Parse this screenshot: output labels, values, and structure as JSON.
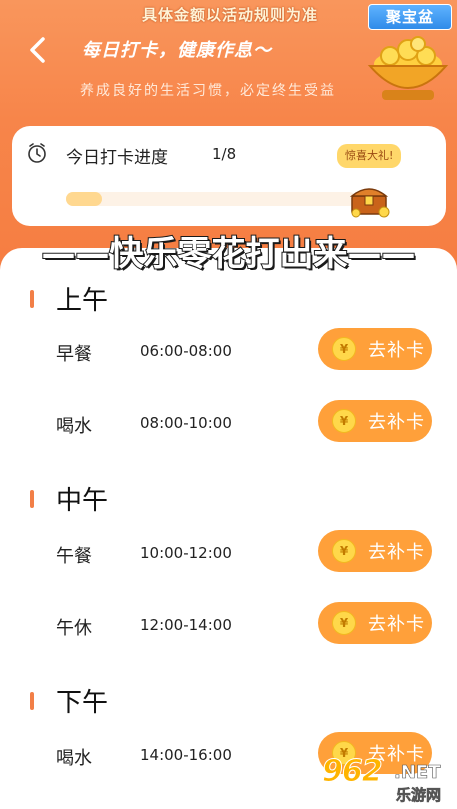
{
  "header": {
    "top_note": "具体金额以活动规则为准",
    "title": "每日打卡，健康作息～",
    "subtitle": "养成良好的生活习惯，必定终生受益",
    "badge_label": "聚宝盆"
  },
  "progress": {
    "label": "今日打卡进度",
    "count": "1/8",
    "fraction": 0.125,
    "gift_bubble": "惊喜大礼!"
  },
  "banner": "——快乐零花打出来——",
  "sections": [
    {
      "title": "上午",
      "rows": [
        {
          "name": "早餐",
          "time": "06:00-08:00",
          "button": "去补卡"
        },
        {
          "name": "喝水",
          "time": "08:00-10:00",
          "button": "去补卡"
        }
      ]
    },
    {
      "title": "中午",
      "rows": [
        {
          "name": "午餐",
          "time": "10:00-12:00",
          "button": "去补卡"
        },
        {
          "name": "午休",
          "time": "12:00-14:00",
          "button": "去补卡"
        }
      ]
    },
    {
      "title": "下午",
      "rows": [
        {
          "name": "喝水",
          "time": "14:00-16:00",
          "button": "去补卡"
        }
      ]
    }
  ],
  "coin_symbol": "¥",
  "watermark": {
    "num": "962",
    "net": ".NET",
    "cn": "乐游网"
  },
  "colors": {
    "accent": "#f7854a",
    "button": "#ffa03a"
  }
}
